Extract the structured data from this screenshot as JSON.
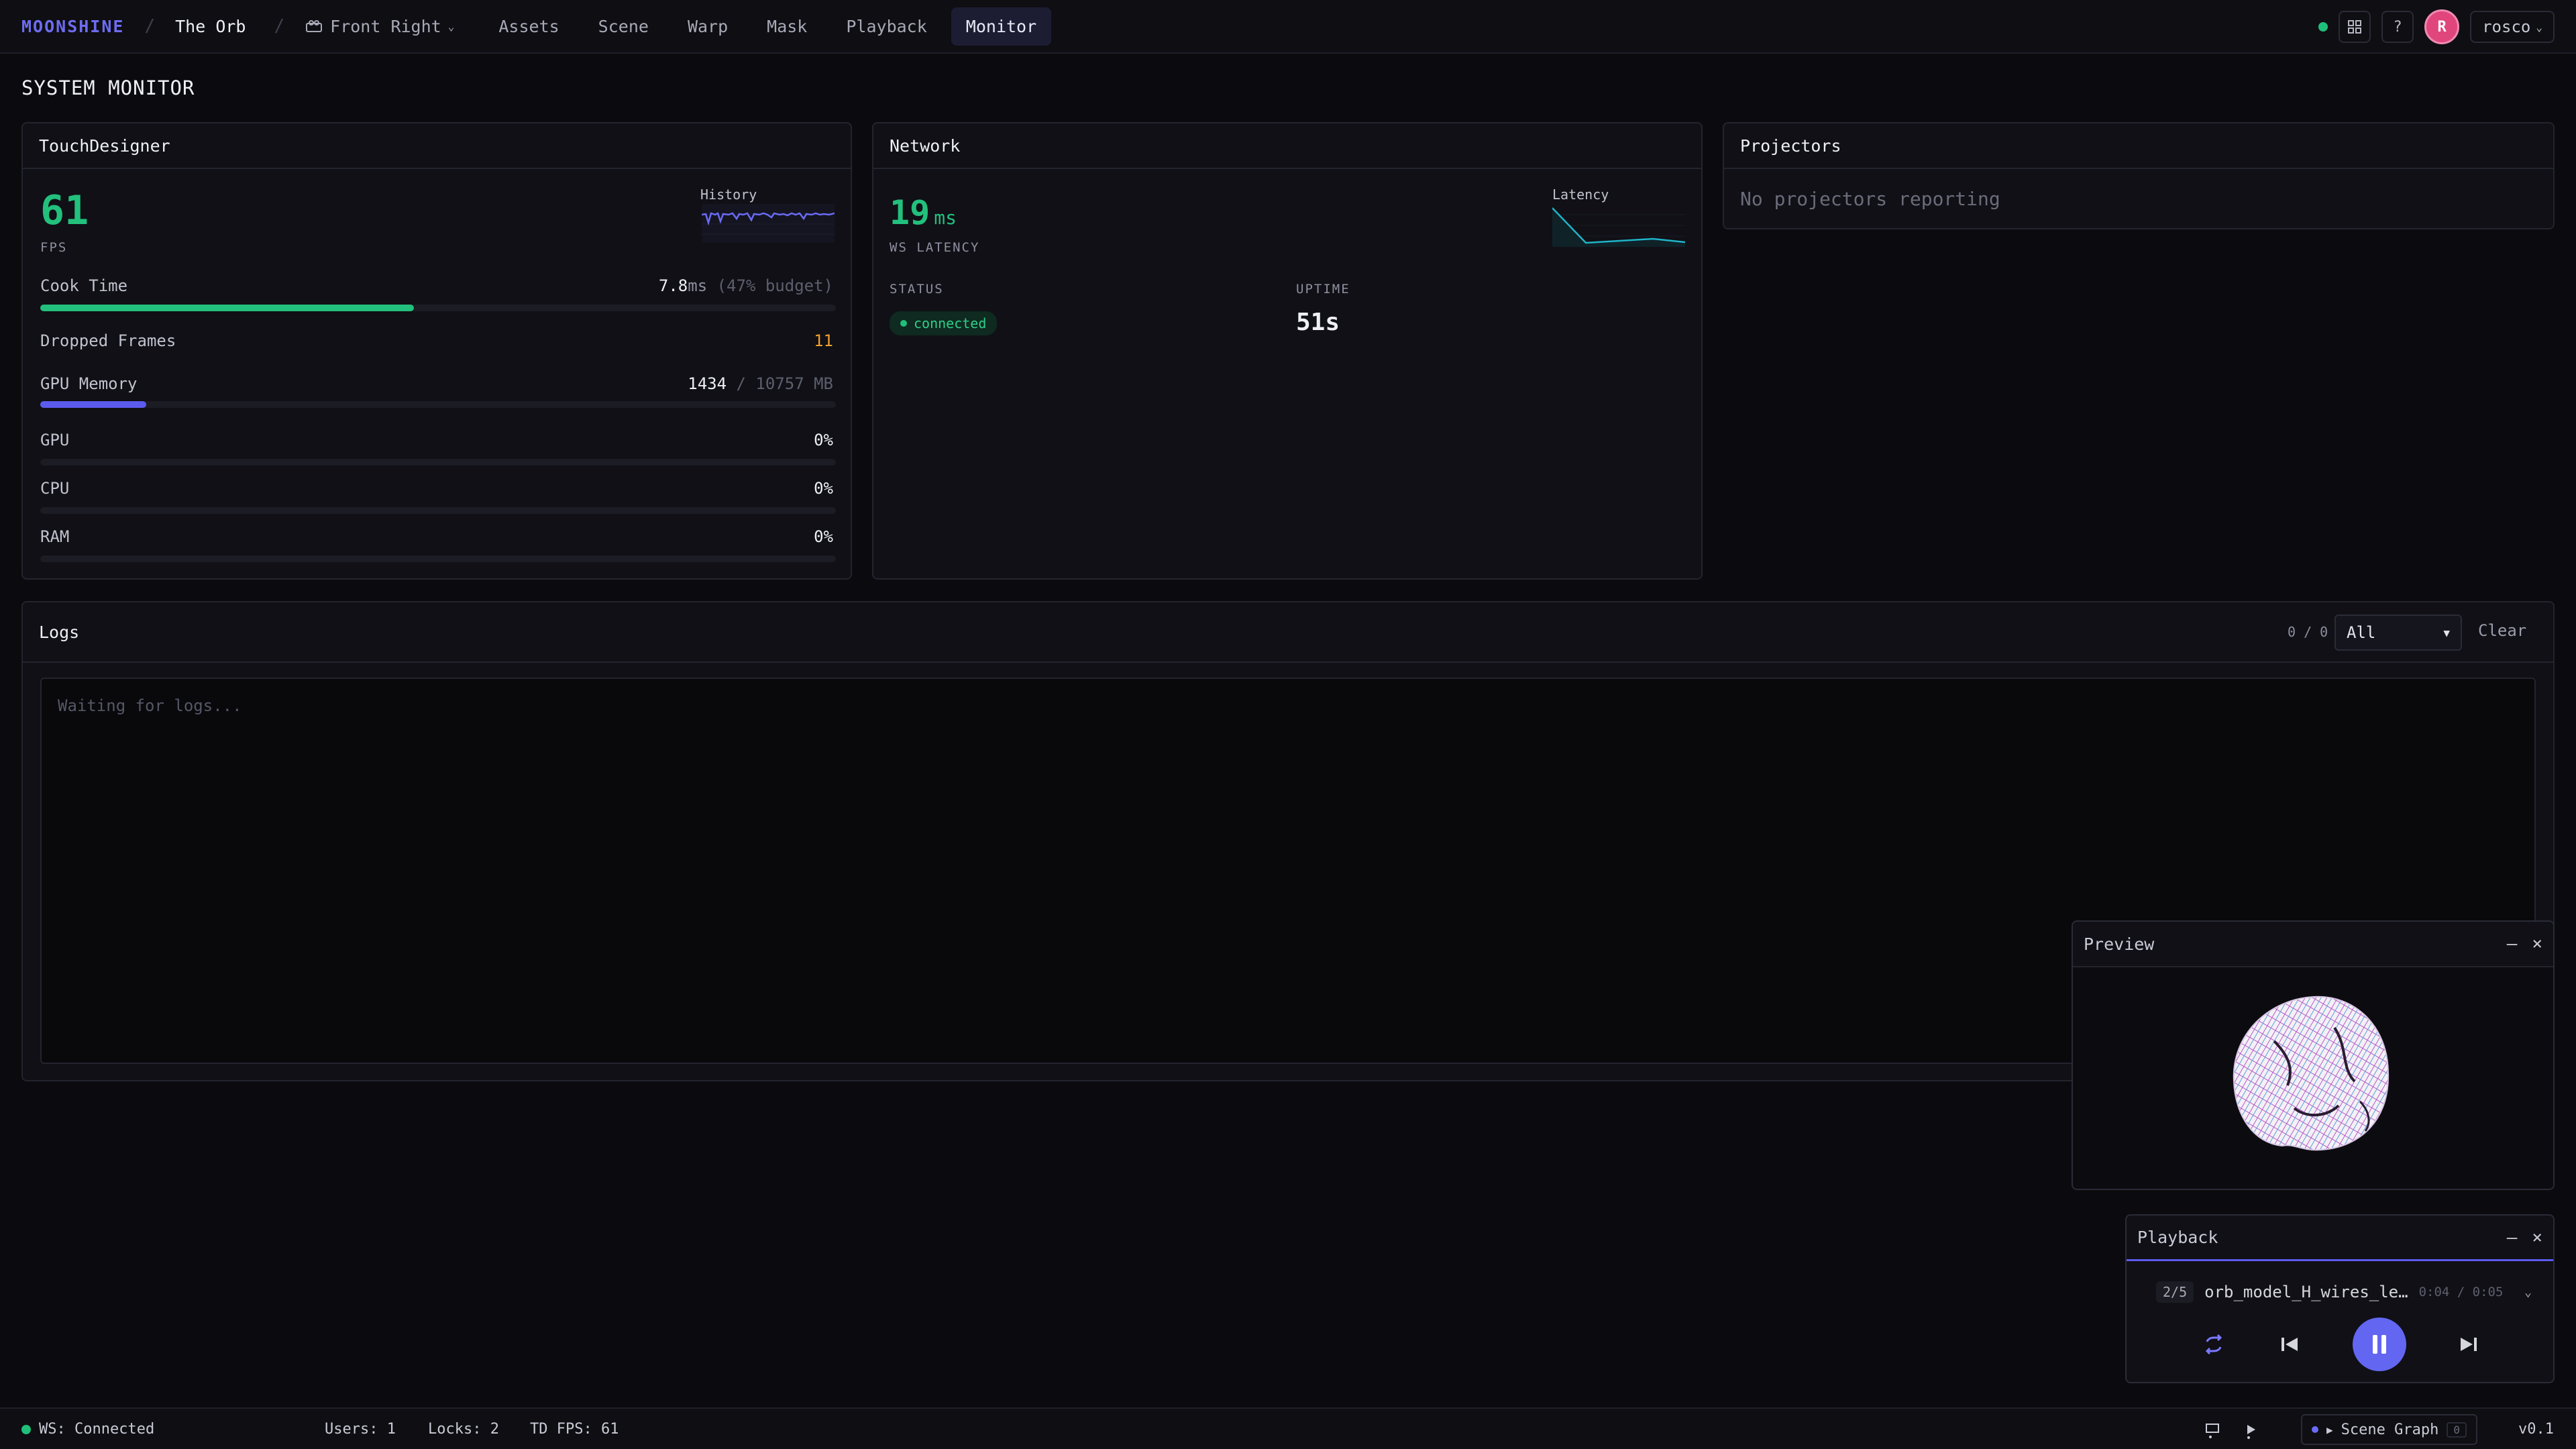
{
  "nav": {
    "brand": "MOONSHINE",
    "project": "The Orb",
    "camera": "Front Right",
    "items": [
      {
        "label": "Assets"
      },
      {
        "label": "Scene"
      },
      {
        "label": "Warp"
      },
      {
        "label": "Mask"
      },
      {
        "label": "Playback"
      },
      {
        "label": "Monitor",
        "active": true
      }
    ],
    "help_label": "?",
    "avatar_initial": "R",
    "user": "rosco"
  },
  "page": {
    "title": "SYSTEM MONITOR"
  },
  "touchdesigner": {
    "title": "TouchDesigner",
    "fps_value": "61",
    "fps_label": "FPS",
    "history_label": "History",
    "cook_label": "Cook Time",
    "cook_value": "7.8",
    "cook_unit": "ms",
    "cook_budget": "(47% budget)",
    "cook_fraction": 0.47,
    "dropped_label": "Dropped Frames",
    "dropped_value": "11",
    "gpu_mem_label": "GPU Memory",
    "gpu_mem_used": "1434",
    "gpu_mem_total": "/ 10757 MB",
    "gpu_mem_fraction": 0.133,
    "gpu_label": "GPU",
    "gpu_value": "0%",
    "cpu_label": "CPU",
    "cpu_value": "0%",
    "ram_label": "RAM",
    "ram_value": "0%",
    "accent": "#22c07c",
    "mem_color": "#5b5bf0"
  },
  "network": {
    "title": "Network",
    "latency_value": "19",
    "latency_unit": "ms",
    "latency_label": "WS LATENCY",
    "chart_label": "Latency",
    "status_label": "STATUS",
    "status_value": "connected",
    "uptime_label": "UPTIME",
    "uptime_value": "51s"
  },
  "projectors": {
    "title": "Projectors",
    "empty": "No projectors reporting"
  },
  "logs": {
    "title": "Logs",
    "count": "0 / 0",
    "filter": "All",
    "clear_label": "Clear",
    "placeholder": "Waiting for logs..."
  },
  "preview": {
    "title": "Preview"
  },
  "playback": {
    "title": "Playback",
    "index": "2/5",
    "file": "orb_model_H_wires_le…",
    "time": "0:04 / 0:05"
  },
  "statusbar": {
    "ws": "WS: Connected",
    "users": "Users: 1",
    "locks": "Locks: 2",
    "td_fps": "TD FPS: 61",
    "scene_graph": "Scene Graph",
    "scene_graph_badge": "0",
    "version": "v0.1"
  }
}
